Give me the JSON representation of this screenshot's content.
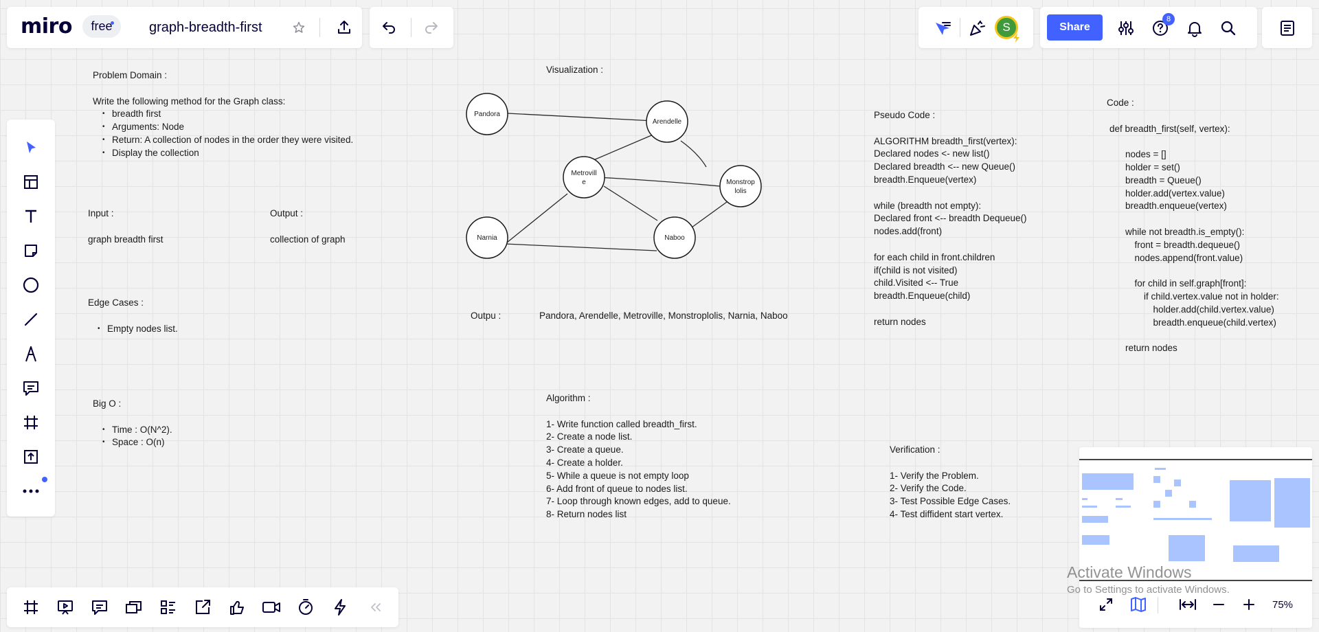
{
  "header": {
    "logo": "miro",
    "plan_badge": "free",
    "board_title": "graph-breadth-first",
    "share_label": "Share",
    "help_badge_count": "8",
    "avatar_initial": "S"
  },
  "board": {
    "problem_domain": {
      "title": "Problem Domain :",
      "intro": "Write the following method for the Graph class:",
      "bullets": [
        "breadth first",
        "Arguments: Node",
        "Return: A collection of nodes in the order they were visited.",
        "Display the collection"
      ]
    },
    "input": {
      "title": "Input :",
      "value": "graph breadth first"
    },
    "output": {
      "title": "Output :",
      "value": "collection of graph"
    },
    "edge_cases": {
      "title": "Edge Cases :",
      "bullets": [
        "Empty nodes list."
      ]
    },
    "big_o": {
      "title": "Big O :",
      "bullets": [
        "Time : O(N^2).",
        "Space : O(n)"
      ]
    },
    "visualization": {
      "title": "Visualization :",
      "nodes": [
        {
          "id": "pandora",
          "label": [
            "Pandora"
          ]
        },
        {
          "id": "arendelle",
          "label": [
            "Arendelle"
          ]
        },
        {
          "id": "metroville",
          "label": [
            "Metrovill",
            "e"
          ]
        },
        {
          "id": "monstropolis",
          "label": [
            "Monstrop",
            "lolis"
          ]
        },
        {
          "id": "narnia",
          "label": [
            "Narnia"
          ]
        },
        {
          "id": "naboo",
          "label": [
            "Naboo"
          ]
        }
      ]
    },
    "output_result": {
      "label": "Outpu :",
      "value": "Pandora, Arendelle, Metroville, Monstroplolis, Narnia, Naboo"
    },
    "algorithm": {
      "title": "Algorithm :",
      "steps": [
        "1- Write function called breadth_first.",
        "2- Create a node list.",
        "3- Create a queue.",
        "4- Create a holder.",
        "5- While a queue is not empty loop",
        "6- Add front of queue to nodes list.",
        "7- Loop through known edges, add to queue.",
        "8- Return nodes list"
      ]
    },
    "pseudo_code": {
      "title": "Pseudo Code :",
      "lines": [
        "ALGORITHM breadth_first(vertex):",
        "Declared nodes <- new list()",
        "Declared breadth <-- new Queue()",
        "breadth.Enqueue(vertex)",
        "",
        "while (breadth not empty):",
        "Declared front <-- breadth Dequeue()",
        "nodes.add(front)",
        "",
        "for each child in front.children",
        "if(child is not visited)",
        "child.Visited <-- True",
        "breadth.Enqueue(child)",
        "",
        "return nodes"
      ]
    },
    "code": {
      "title": "Code :",
      "lines": [
        {
          "t": "def breadth_first(self, vertex):",
          "i": 0
        },
        {
          "t": "",
          "i": 0
        },
        {
          "t": "nodes = []",
          "i": 1
        },
        {
          "t": "holder = set()",
          "i": 1
        },
        {
          "t": "breadth = Queue()",
          "i": 1
        },
        {
          "t": "holder.add(vertex.value)",
          "i": 1
        },
        {
          "t": "breadth.enqueue(vertex)",
          "i": 1
        },
        {
          "t": "",
          "i": 0
        },
        {
          "t": "while not breadth.is_empty():",
          "i": 1
        },
        {
          "t": "front = breadth.dequeue()",
          "i": 2
        },
        {
          "t": "nodes.append(front.value)",
          "i": 2
        },
        {
          "t": "",
          "i": 0
        },
        {
          "t": "for child in self.graph[front]:",
          "i": 2
        },
        {
          "t": "if child.vertex.value not in holder:",
          "i": 3
        },
        {
          "t": "holder.add(child.vertex.value)",
          "i": 4
        },
        {
          "t": "breadth.enqueue(child.vertex)",
          "i": 4
        },
        {
          "t": "",
          "i": 0
        },
        {
          "t": "return nodes",
          "i": 1
        }
      ]
    },
    "verification": {
      "title": "Verification :",
      "steps": [
        "1- Verify the Problem.",
        "2- Verify the Code.",
        "3- Test Possible Edge Cases.",
        "4- Test diffident start vertex."
      ]
    }
  },
  "left_toolbar": {
    "tools": [
      "select-tool",
      "templates-tool",
      "text-tool",
      "sticky-note-tool",
      "shape-tool",
      "line-tool",
      "pen-tool",
      "comment-tool",
      "frame-tool",
      "upload-tool",
      "more-tools"
    ]
  },
  "bottom_toolbar": {
    "tools": [
      "frames-icon",
      "presentation-icon",
      "comments-icon",
      "cards-icon",
      "list-icon",
      "share-screen-icon",
      "reactions-icon",
      "video-icon",
      "timer-icon",
      "lightning-icon",
      "collapse-icon"
    ]
  },
  "zoom": {
    "level": "75%"
  },
  "watermark": {
    "title": "Activate Windows",
    "subtitle": "Go to Settings to activate Windows."
  },
  "colors": {
    "accent": "#4262ff",
    "avatar_bg": "#3f9a3b",
    "avatar_ring": "#f5c518",
    "minimap_block": "#a9c4ff"
  }
}
